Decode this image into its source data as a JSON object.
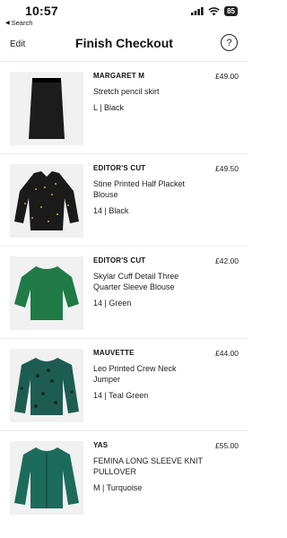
{
  "status": {
    "time": "10:57",
    "back_label": "Search",
    "battery": "85"
  },
  "nav": {
    "edit_label": "Edit",
    "title": "Finish Checkout",
    "help_label": "?"
  },
  "items": [
    {
      "brand": "MARGARET M",
      "name": "Stretch pencil skirt",
      "variant": "L | Black",
      "price": "£49.00",
      "garment": "skirt",
      "color": "#1c1c1c"
    },
    {
      "brand": "EDITOR'S CUT",
      "name": "Stine Printed Half Placket Blouse",
      "variant": "14 | Black",
      "price": "£49.50",
      "garment": "blouse",
      "color": "#1a1a1a"
    },
    {
      "brand": "EDITOR'S CUT",
      "name": "Skylar Cuff Detail Three Quarter Sleeve Blouse",
      "variant": "14 | Green",
      "price": "£42.00",
      "garment": "top",
      "color": "#1f7a47"
    },
    {
      "brand": "MAUVETTE",
      "name": "Leo Printed Crew Neck Jumper",
      "variant": "14 | Teal Green",
      "price": "£44.00",
      "garment": "jumper",
      "color": "#1e5c52"
    },
    {
      "brand": "YAS",
      "name": "FEMINA LONG SLEEVE KNIT PULLOVER",
      "variant": "M | Turquoise",
      "price": "£55.00",
      "garment": "knit",
      "color": "#1d6b5a"
    }
  ]
}
